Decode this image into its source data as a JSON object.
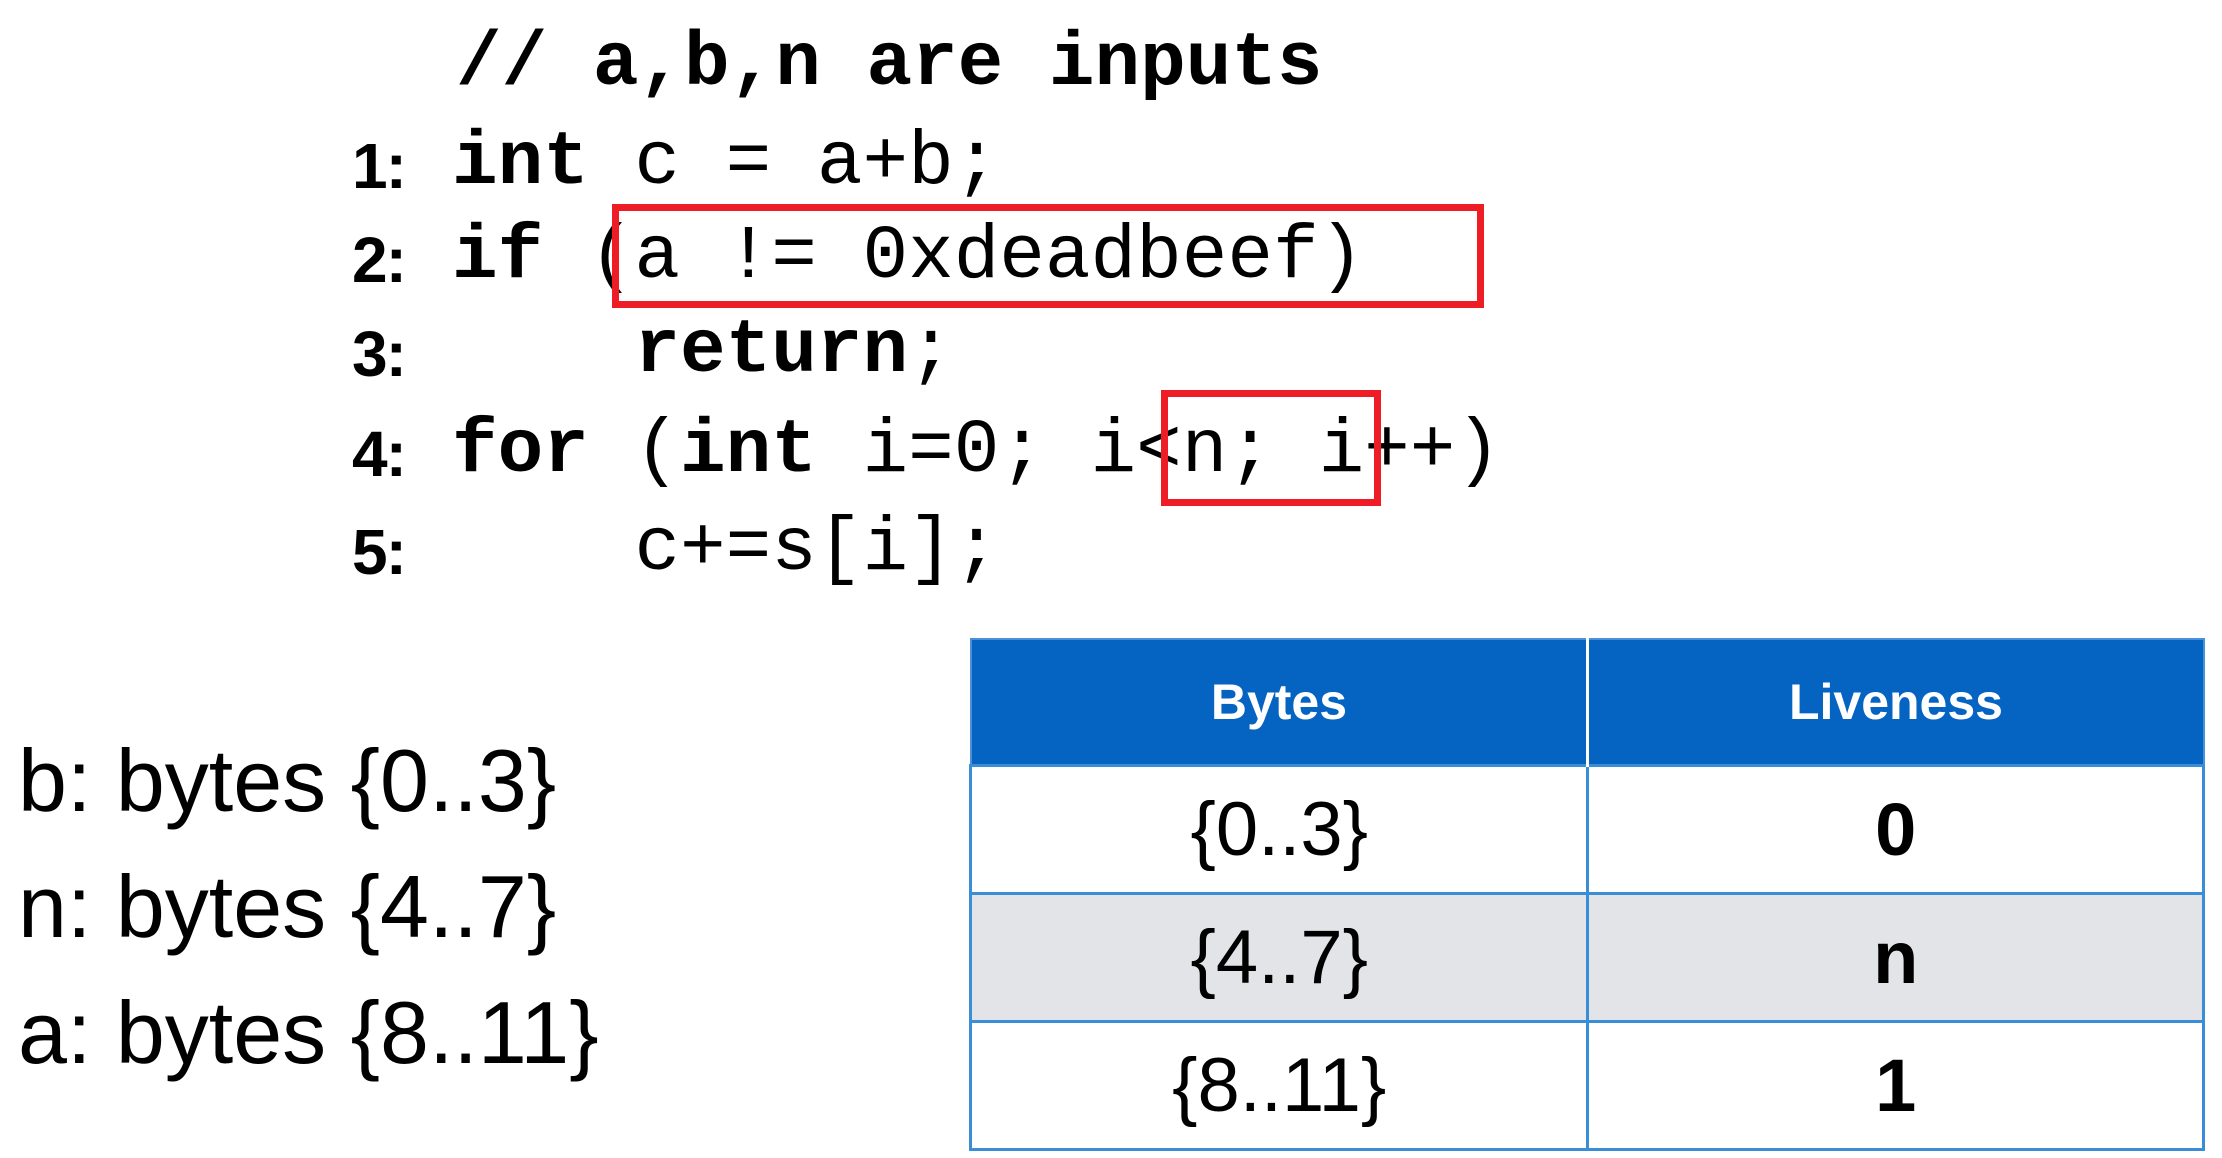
{
  "code": {
    "comment": "// a,b,n are inputs",
    "lines": [
      {
        "num": "1:",
        "kw": "int",
        "rest": " c = a+b;"
      },
      {
        "num": "2:",
        "kw": "if",
        "gap": " ",
        "highlight": "(a != 0xdeadbeef)"
      },
      {
        "num": "3:",
        "indent": "    ",
        "kw": "return",
        "rest": ";"
      },
      {
        "num": "4:",
        "kw": "for",
        "pre": " (",
        "kw2": "int",
        "mid": " i=0; ",
        "highlight": "i<n;",
        "post": " i++)"
      },
      {
        "num": "5:",
        "indent": "    ",
        "rest": "c+=s[i];"
      }
    ]
  },
  "byte_map": [
    "b: bytes {0..3}",
    "n: bytes {4..7}",
    "a: bytes {8..11}"
  ],
  "table": {
    "headers": [
      "Bytes",
      "Liveness"
    ],
    "rows": [
      {
        "bytes": "{0..3}",
        "liveness": "0"
      },
      {
        "bytes": "{4..7}",
        "liveness": "n"
      },
      {
        "bytes": "{8..11}",
        "liveness": "1"
      }
    ]
  },
  "colors": {
    "highlight_border": "#ee1c25",
    "header_fill": "#0563c1",
    "row_shade": "#e3e4e8",
    "table_border": "#3a8ed8"
  }
}
